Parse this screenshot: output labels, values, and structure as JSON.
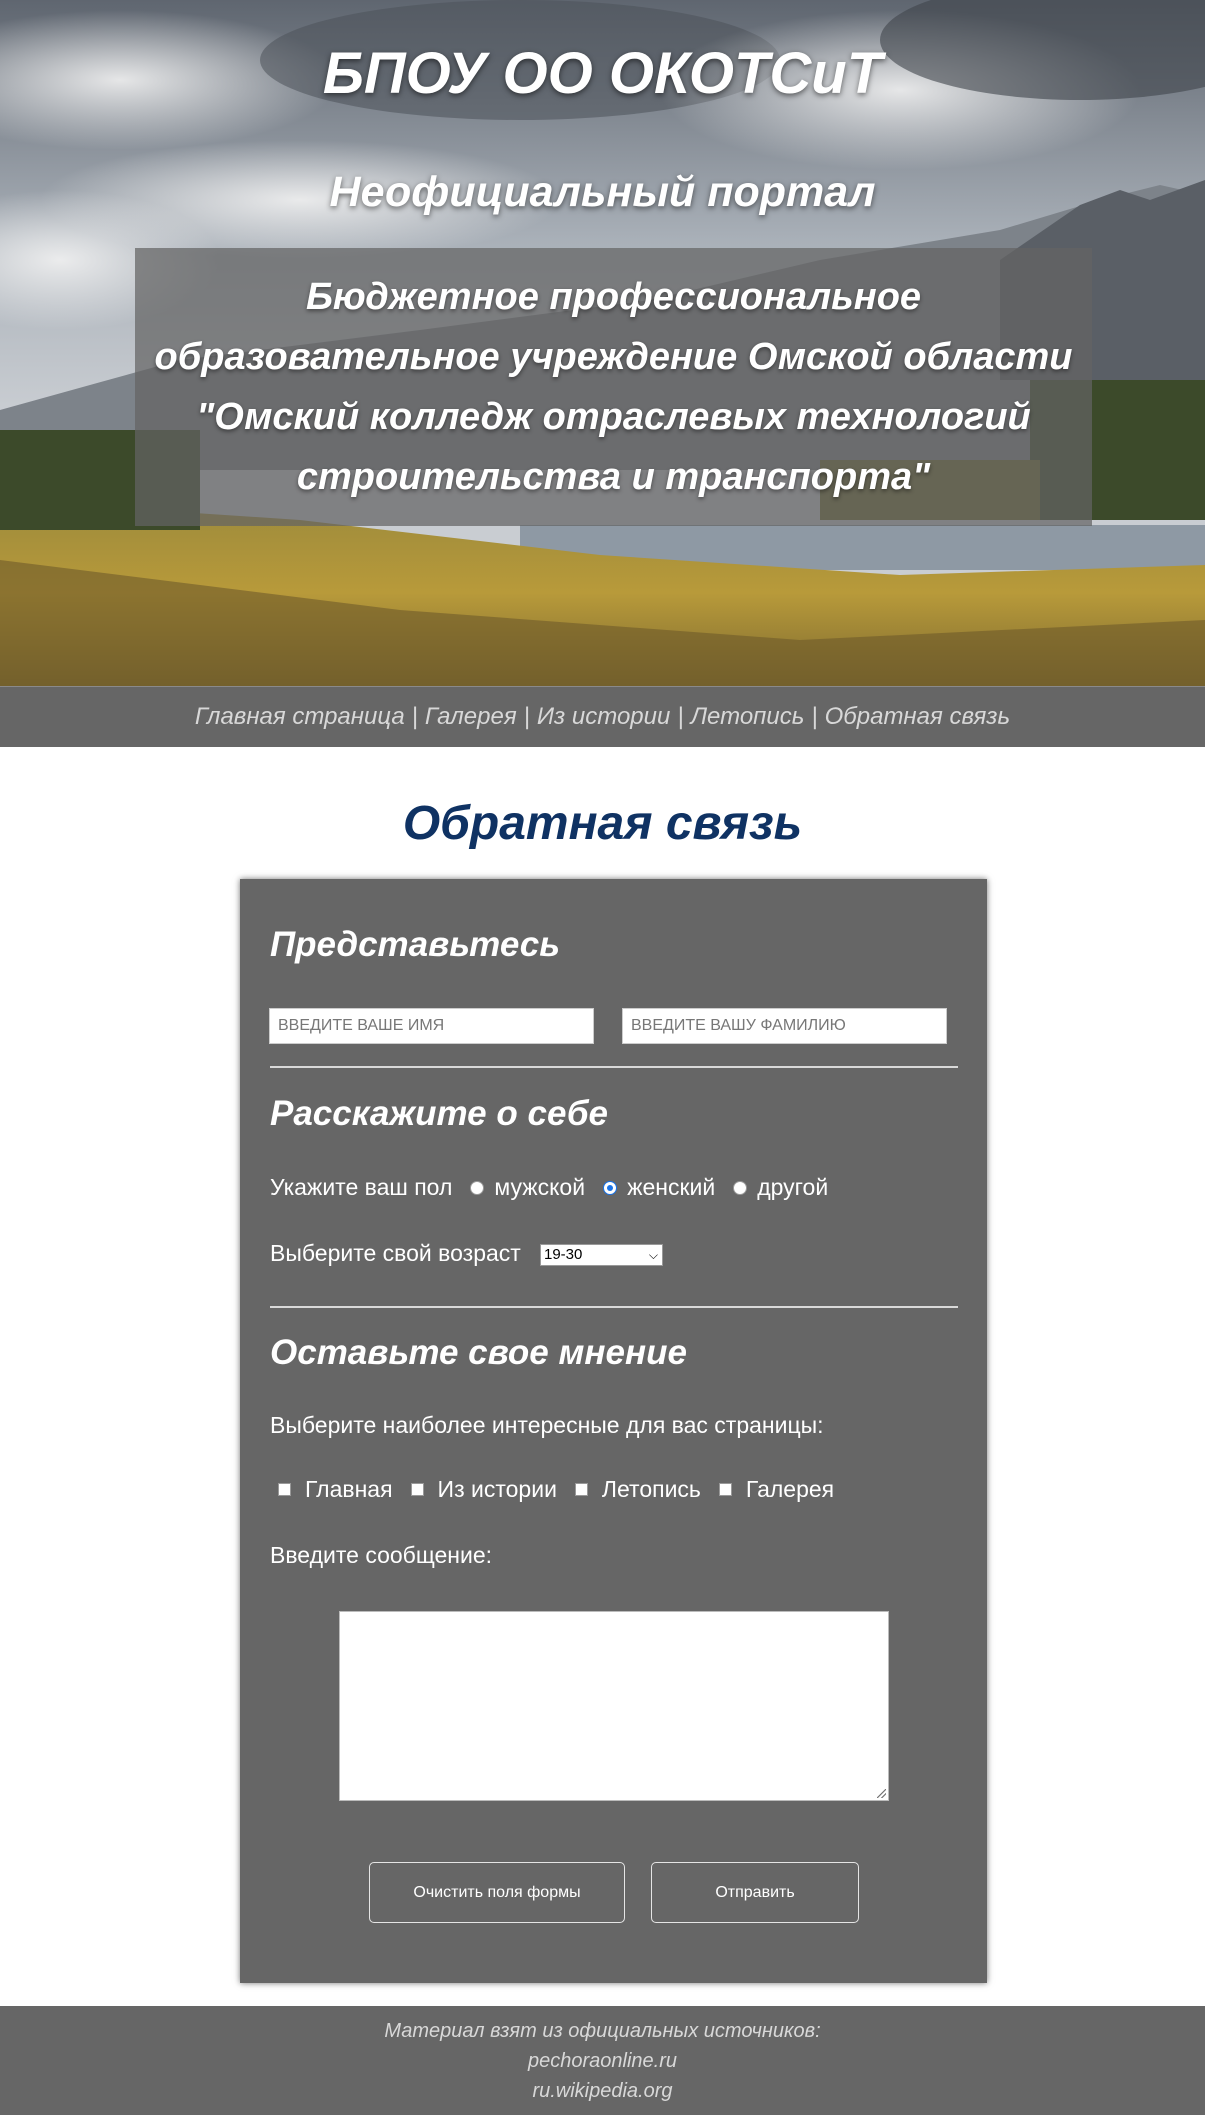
{
  "header": {
    "title": "БПОУ ОО ОКОТСиТ",
    "subtitle": "Неофициальный портал",
    "description": "Бюджетное профессиональное образовательное учреждение Омской области \"Омский колледж отраслевых технологий строительства и транспорта\""
  },
  "nav": {
    "items": [
      {
        "label": "Главная страница"
      },
      {
        "label": "Галерея"
      },
      {
        "label": "Из истории"
      },
      {
        "label": "Летопись"
      },
      {
        "label": "Обратная связь"
      }
    ],
    "separator": "|"
  },
  "page": {
    "title": "Обратная связь"
  },
  "form": {
    "section1": {
      "heading": "Представьтесь",
      "first_name_placeholder": "ВВЕДИТЕ ВАШЕ ИМЯ",
      "last_name_placeholder": "ВВЕДИТЕ ВАШУ ФАМИЛИЮ"
    },
    "section2": {
      "heading": "Расскажите о себе",
      "gender_label": "Укажите ваш пол",
      "gender_options": [
        {
          "label": "мужской",
          "checked": false
        },
        {
          "label": "женский",
          "checked": true
        },
        {
          "label": "другой",
          "checked": false
        }
      ],
      "age_label": "Выберите свой возраст",
      "age_selected": "19-30"
    },
    "section3": {
      "heading": "Оставьте свое мнение",
      "pages_label": "Выберите наиболее интересные для вас страницы:",
      "pages_options": [
        {
          "label": "Главная",
          "checked": false
        },
        {
          "label": "Из истории",
          "checked": false
        },
        {
          "label": "Летопись",
          "checked": false
        },
        {
          "label": "Галерея",
          "checked": false
        }
      ],
      "message_label": "Введите сообщение:",
      "message_value": ""
    },
    "buttons": {
      "reset_label": "Очистить поля формы",
      "submit_label": "Отправить"
    }
  },
  "footer": {
    "line1": "Материал взят из официальных источников:",
    "line2": "pechoraonline.ru",
    "line3": "ru.wikipedia.org"
  },
  "colors": {
    "nav_bg": "#666666",
    "panel_bg": "#666666",
    "title_color": "#0f3263",
    "radio_accent": "#1a73e8"
  }
}
